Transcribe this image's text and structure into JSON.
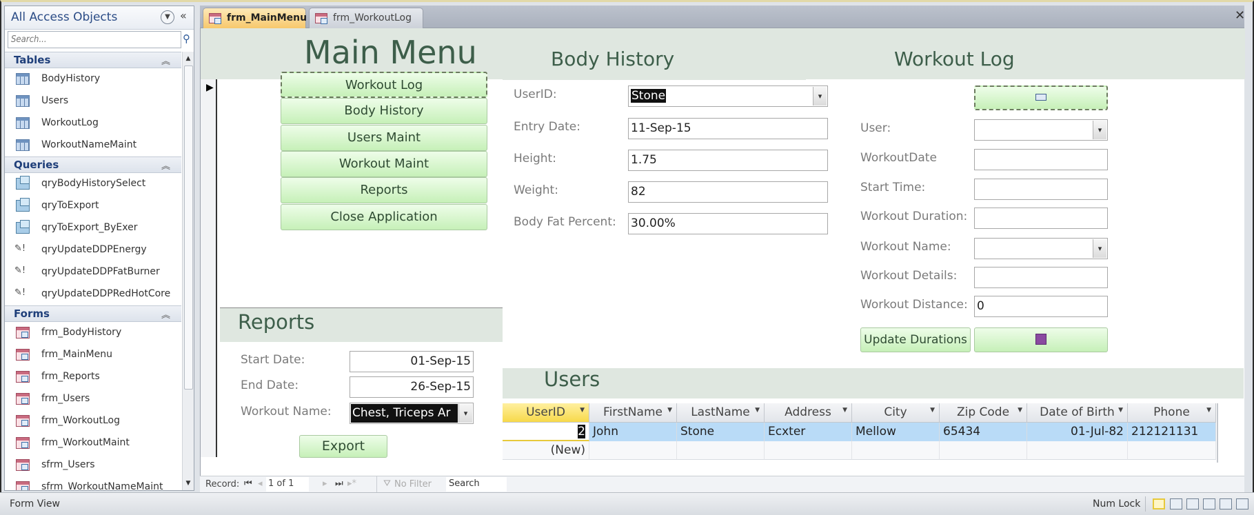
{
  "nav": {
    "title": "All Access Objects",
    "search_placeholder": "Search...",
    "groups": [
      {
        "label": "Tables",
        "items": [
          "BodyHistory",
          "Users",
          "WorkoutLog",
          "WorkoutNameMaint"
        ]
      },
      {
        "label": "Queries",
        "items": [
          "qryBodyHistorySelect",
          "qryToExport",
          "qryToExport_ByExer",
          "qryUpdateDDPEnergy",
          "qryUpdateDDPFatBurner",
          "qryUpdateDDPRedHotCore"
        ]
      },
      {
        "label": "Forms",
        "items": [
          "frm_BodyHistory",
          "frm_MainMenu",
          "frm_Reports",
          "frm_Users",
          "frm_WorkoutLog",
          "frm_WorkoutMaint",
          "sfrm_Users",
          "sfrm_WorkoutNameMaint"
        ]
      }
    ]
  },
  "tabs": [
    {
      "label": "frm_MainMenu",
      "active": true
    },
    {
      "label": "frm_WorkoutLog",
      "active": false
    }
  ],
  "main_menu": {
    "title": "Main Menu",
    "buttons": [
      "Workout Log",
      "Body History",
      "Users Maint",
      "Workout Maint",
      "Reports",
      "Close Application"
    ]
  },
  "body_history": {
    "title": "Body History",
    "fields": [
      {
        "label": "UserID:",
        "value": "Stone",
        "type": "combo"
      },
      {
        "label": "Entry Date:",
        "value": "11-Sep-15"
      },
      {
        "label": "Height:",
        "value": "1.75"
      },
      {
        "label": "Weight:",
        "value": "82"
      },
      {
        "label": "Body Fat Percent:",
        "value": "30.00%"
      }
    ]
  },
  "workout_log": {
    "title": "Workout Log",
    "fields": [
      {
        "label": "User:",
        "value": "",
        "type": "combo"
      },
      {
        "label": "WorkoutDate",
        "value": ""
      },
      {
        "label": "Start Time:",
        "value": ""
      },
      {
        "label": "Workout Duration:",
        "value": ""
      },
      {
        "label": "Workout Name:",
        "value": "",
        "type": "combo"
      },
      {
        "label": "Workout Details:",
        "value": ""
      },
      {
        "label": "Workout Distance:",
        "value": "0"
      }
    ],
    "update_button": "Update Durations"
  },
  "reports": {
    "title": "Reports",
    "start_label": "Start Date:",
    "start_value": "01-Sep-15",
    "end_label": "End Date:",
    "end_value": "26-Sep-15",
    "workout_label": "Workout Name:",
    "workout_value": "Chest, Triceps Ar",
    "export_button": "Export"
  },
  "users": {
    "title": "Users",
    "columns": [
      "UserID",
      "FirstName",
      "LastName",
      "Address",
      "City",
      "Zip Code",
      "Date of Birth",
      "Phone"
    ],
    "rows": [
      [
        "2",
        "John",
        "Stone",
        "Ecxter",
        "Mellow",
        "65434",
        "01-Jul-82",
        "212121131"
      ]
    ],
    "new_row_label": "(New)"
  },
  "record_nav": {
    "label": "Record:",
    "position": "1 of 1",
    "filter": "No Filter",
    "search": "Search"
  },
  "status": {
    "view": "Form View",
    "numlock": "Num Lock"
  }
}
